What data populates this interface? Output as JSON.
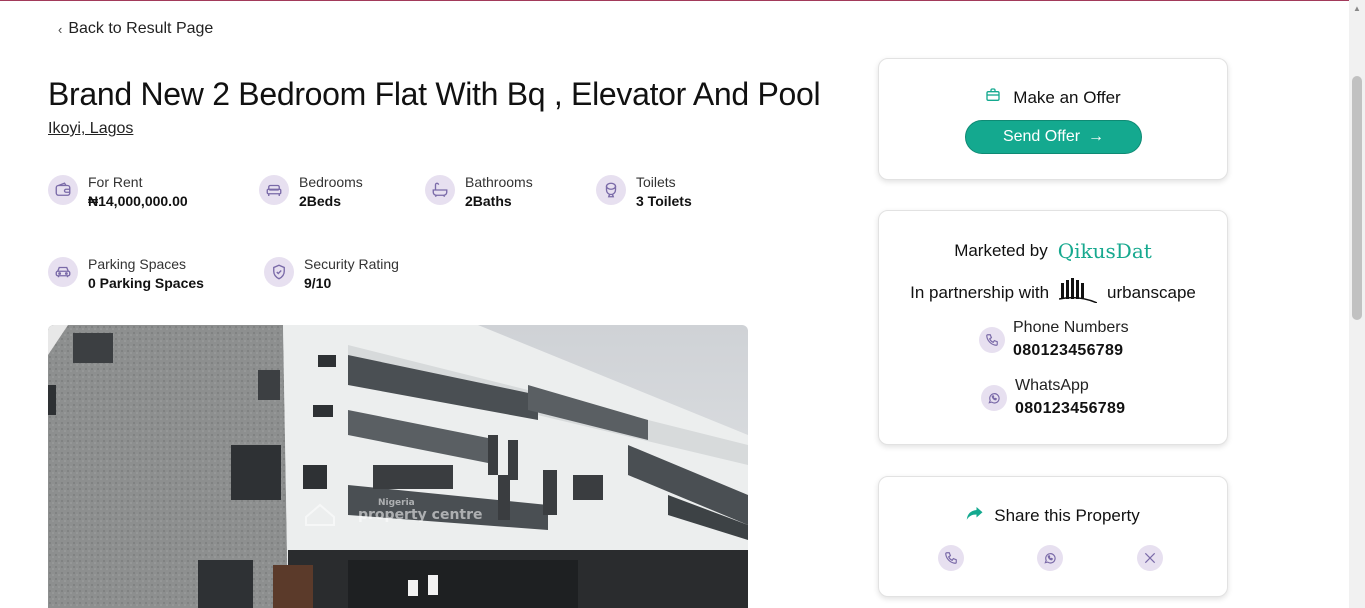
{
  "nav": {
    "back_label": "Back to Result Page"
  },
  "listing": {
    "title": "Brand New 2 Bedroom Flat With Bq , Elevator And Pool",
    "location": "Ikoyi, Lagos",
    "features": [
      {
        "label": "For Rent",
        "value": "₦14,000,000.00",
        "icon": "wallet-icon"
      },
      {
        "label": "Bedrooms",
        "value": "2Beds",
        "icon": "bed-icon"
      },
      {
        "label": "Bathrooms",
        "value": "2Baths",
        "icon": "bathtub-icon"
      },
      {
        "label": "Toilets",
        "value": "3 Toilets",
        "icon": "toilet-icon"
      },
      {
        "label": "Parking Spaces",
        "value": "0 Parking Spaces",
        "icon": "car-icon"
      },
      {
        "label": "Security Rating",
        "value": "9/10",
        "icon": "shield-check-icon"
      }
    ],
    "photo_watermark": {
      "small": "Nigeria",
      "large": "property centre"
    }
  },
  "offer": {
    "heading": "Make an Offer",
    "button_label": "Send Offer"
  },
  "marketer": {
    "marketed_by_label": "Marketed by",
    "brand_name": "QikusDat",
    "partnership_label": "In partnership with",
    "partner_name": "urbanscape",
    "phone_label": "Phone Numbers",
    "phone_value": "080123456789",
    "whatsapp_label": "WhatsApp",
    "whatsapp_value": "080123456789"
  },
  "share": {
    "heading": "Share this Property"
  },
  "colors": {
    "accent": "#14a98f",
    "icon_bg": "#e7e0f0",
    "icon_stroke": "#7a6aa8"
  }
}
